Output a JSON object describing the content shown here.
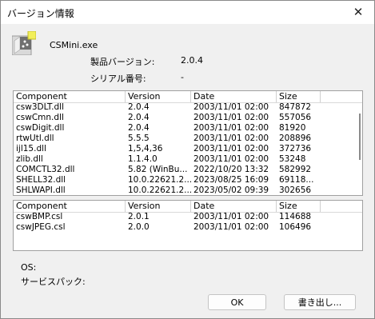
{
  "window": {
    "title": "バージョン情報",
    "close_glyph": "✕"
  },
  "app": {
    "icon": "app-icon",
    "exe_name": "CSMini.exe",
    "product_version_label": "製品バージョン:",
    "product_version_value": "2.0.4",
    "serial_label": "シリアル番号:",
    "serial_value": "-"
  },
  "columns": [
    "Component",
    "Version",
    "Date",
    "Size"
  ],
  "components": [
    [
      "csw3DLT.dll",
      "2.0.4",
      "2003/11/01 02:00",
      "847872"
    ],
    [
      "cswCmn.dll",
      "2.0.4",
      "2003/11/01 02:00",
      "557056"
    ],
    [
      "cswDigit.dll",
      "2.0.4",
      "2003/11/01 02:00",
      "81920"
    ],
    [
      "rtwUtl.dll",
      "5.5.5",
      "2003/11/01 02:00",
      "208896"
    ],
    [
      "ijl15.dll",
      "1,5,4,36",
      "2003/11/01 02:00",
      "372736"
    ],
    [
      "zlib.dll",
      "1.1.4.0",
      "2003/11/01 02:00",
      "53248"
    ],
    [
      "COMCTL32.dll",
      "5.82 (WinBu...",
      "2022/10/20 13:32",
      "582992"
    ],
    [
      "SHELL32.dll",
      "10.0.22621.2...",
      "2023/08/25 16:09",
      "69118..."
    ],
    [
      "SHLWAPI.dll",
      "10.0.22621.2...",
      "2023/05/02 09:39",
      "302656"
    ]
  ],
  "plugins": [
    [
      "cswBMP.csl",
      "2.0.1",
      "2003/11/01 02:00",
      "114688"
    ],
    [
      "cswJPEG.csl",
      "2.0.0",
      "2003/11/01 02:00",
      "106496"
    ]
  ],
  "system": {
    "os_label": "OS:",
    "service_pack_label": "サービスパック:"
  },
  "buttons": {
    "ok": "OK",
    "export": "書き出し..."
  }
}
